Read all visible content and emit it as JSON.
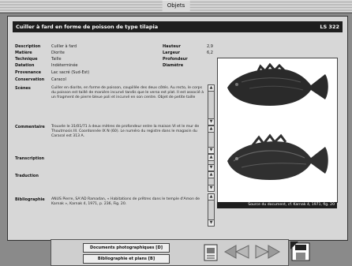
{
  "window": {
    "title": "Objets"
  },
  "record": {
    "title": "Cuiller à fard en forme de poisson de type tilapia",
    "id": "LS 322",
    "fields": [
      {
        "label": "Description",
        "value": "Cuiller à fard"
      },
      {
        "label": "Matière",
        "value": "Diorite"
      },
      {
        "label": "Technique",
        "value": "Taille"
      },
      {
        "label": "Datation",
        "value": "Indéterminée"
      },
      {
        "label": "Provenance",
        "value": "Lac sacré (Sud-Est)"
      },
      {
        "label": "Conservation",
        "value": "Caracol"
      }
    ],
    "dims": [
      {
        "label": "Hauteur",
        "value": "2,9"
      },
      {
        "label": "Largeur",
        "value": "6,2"
      },
      {
        "label": "Profondeur",
        "value": ""
      },
      {
        "label": "Diamètre",
        "value": ""
      }
    ],
    "scenes": {
      "label": "Scènes",
      "text": "Cuiller en diorite, en forme de poisson, coupillée des deux côtés. Au recto, le corps du poisson est taillé de manière incurvé tandis que le verso est plat. Il est associé à un fragment de pierre bleue poli et incurvé en son centre. Objet de petite taille"
    },
    "commentaire": {
      "label": "Commentaire",
      "text": "Trouvée le 31/01/71 à deux mètres de profondeur entre la maison VI et le mur de Thoutmosis III. Coordonnée IX N (60). Le numéro du registre dans le magasin du Caracol est 313 A."
    },
    "transcription": {
      "label": "Transcription",
      "text": ""
    },
    "traduction": {
      "label": "Traduction",
      "text": ""
    },
    "bibliographie": {
      "label": "Bibliographie",
      "text": "ANUS Pierre, SA'AD Ramadan, « Habitations de prêtres dans le temple d'Amon de Karnak », Karnak 4, 1971, p. 236, Fig. 20."
    }
  },
  "photo": {
    "caption": "Source du document, cf. Karnak 4, 1971, fig. 20"
  },
  "buttons": {
    "docs": "Documents photographiques [D]",
    "biblio": "Bibliographie et plans [B]"
  },
  "icons": {
    "page": "document-icon",
    "prev": "rewind-icon",
    "next": "forward-icon",
    "quit": "floppy-exit-icon"
  }
}
